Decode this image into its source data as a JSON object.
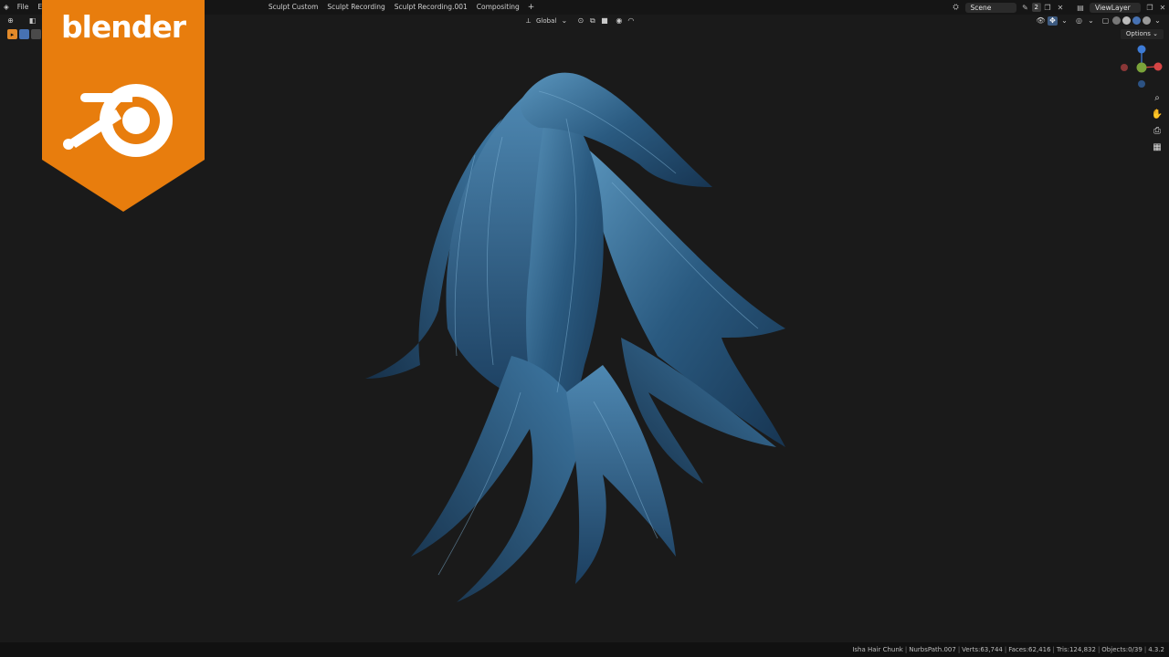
{
  "menubar": {
    "menus": [
      "File",
      "Edit"
    ],
    "workspaces": [
      "Sculpt Custom",
      "Sculpt Recording",
      "Sculpt Recording.001",
      "Compositing"
    ],
    "add_tab": "+",
    "scene": "Scene",
    "scene_count": "2",
    "view_layer": "ViewLayer"
  },
  "viewport_header": {
    "transform_orientation": "Global",
    "options_label": "Options"
  },
  "gizmo": {
    "axes": [
      {
        "name": "Z",
        "color": "#3d7bd6"
      },
      {
        "name": "X",
        "color": "#d64545"
      },
      {
        "name": "Y",
        "color": "#7aa33a"
      }
    ]
  },
  "logo": {
    "text": "blender",
    "color": "#e87d0d"
  },
  "statusbar": {
    "object": "Isha Hair Chunk",
    "path": "NurbsPath.007",
    "verts": "Verts:63,744",
    "faces": "Faces:62,416",
    "tris": "Tris:124,832",
    "objects": "Objects:0/39",
    "version": "4.3.2"
  },
  "colors": {
    "hair_base": "#2a5a80",
    "hair_light": "#5a95bd",
    "hair_dark": "#173552",
    "background": "#1a1a1a"
  }
}
